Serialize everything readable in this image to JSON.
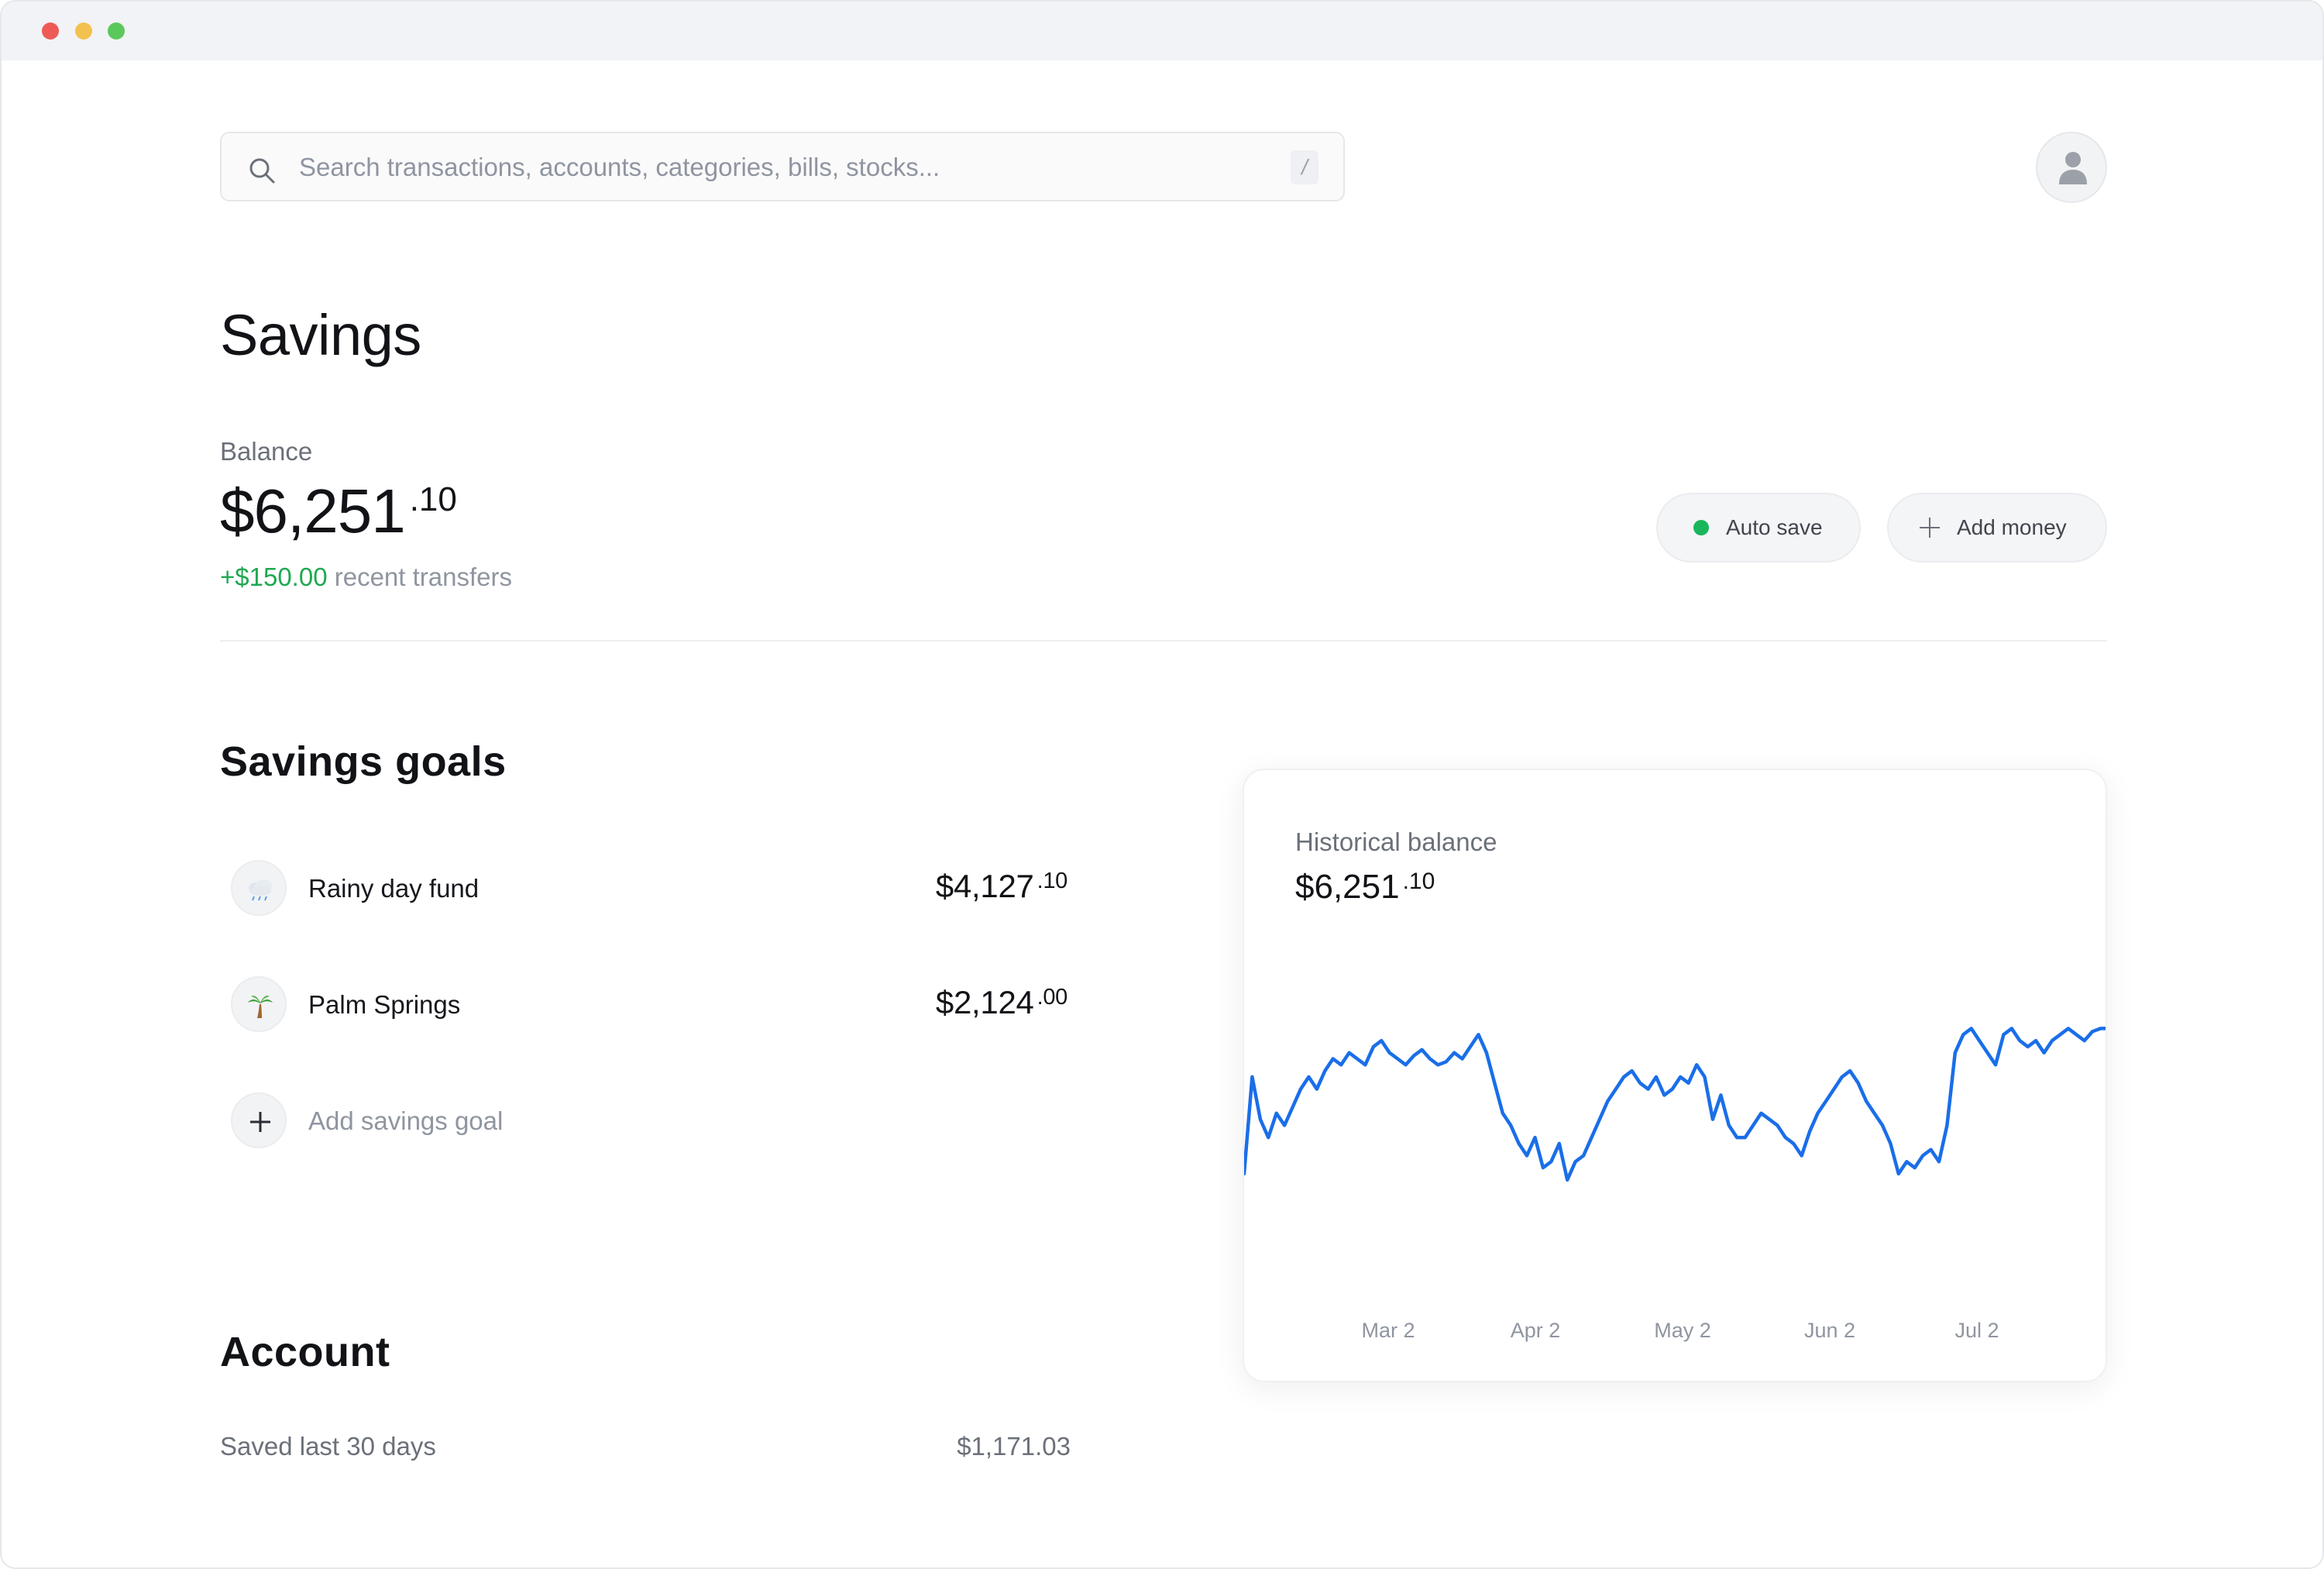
{
  "window": {
    "controls": [
      "close",
      "minimize",
      "maximize"
    ]
  },
  "search": {
    "placeholder": "Search transactions, accounts, categories, bills, stocks...",
    "value": "",
    "shortcut": "/",
    "icon": "search-icon"
  },
  "header": {
    "avatar_icon": "user-icon"
  },
  "page": {
    "title": "Savings"
  },
  "balance": {
    "label": "Balance",
    "whole": "$6,251",
    "cents": ".10",
    "change_amount": "+$150.00",
    "change_text": "recent transfers"
  },
  "actions": {
    "auto_save_label": "Auto save",
    "auto_save_status_color": "#1ab65c",
    "add_money_label": "Add money"
  },
  "goals": {
    "title": "Savings goals",
    "items": [
      {
        "name": "Rainy day fund",
        "whole": "$4,127",
        "cents": ".10",
        "icon": "rain-cloud-icon"
      },
      {
        "name": "Palm Springs",
        "whole": "$2,124",
        "cents": ".00",
        "icon": "palm-tree-icon"
      }
    ],
    "add_label": "Add savings goal"
  },
  "account": {
    "title": "Account",
    "rows": [
      {
        "label": "Saved last 30 days",
        "value": "$1,171.03"
      }
    ]
  },
  "chart_card": {
    "label": "Historical balance",
    "whole": "$6,251",
    "cents": ".10"
  },
  "chart_data": {
    "type": "line",
    "title": "Historical balance",
    "line_color": "#1a6ee8",
    "x_ticks": [
      "Mar 2",
      "Apr 2",
      "May 2",
      "Jun 2",
      "Jul 2"
    ],
    "series": [
      {
        "values": [
          6150,
          6310,
          6240,
          6210,
          6250,
          6230,
          6260,
          6290,
          6310,
          6290,
          6320,
          6340,
          6330,
          6350,
          6340,
          6330,
          6360,
          6370,
          6350,
          6340,
          6330,
          6345,
          6355,
          6340,
          6330,
          6335,
          6350,
          6340,
          6360,
          6380,
          6350,
          6300,
          6250,
          6230,
          6200,
          6180,
          6210,
          6160,
          6170,
          6200,
          6140,
          6170,
          6180,
          6210,
          6240,
          6270,
          6290,
          6310,
          6320,
          6300,
          6290,
          6310,
          6280,
          6290,
          6310,
          6300,
          6330,
          6310,
          6240,
          6280,
          6230,
          6210,
          6210,
          6230,
          6250,
          6240,
          6230,
          6210,
          6200,
          6180,
          6220,
          6250,
          6270,
          6290,
          6310,
          6320,
          6300,
          6270,
          6250,
          6230,
          6200,
          6150,
          6170,
          6160,
          6180,
          6190,
          6170,
          6230,
          6350,
          6380,
          6390,
          6370,
          6350,
          6330,
          6380,
          6390,
          6370,
          6360,
          6370,
          6350,
          6370,
          6380,
          6390,
          6380,
          6370,
          6385,
          6390,
          6390
        ]
      }
    ]
  }
}
